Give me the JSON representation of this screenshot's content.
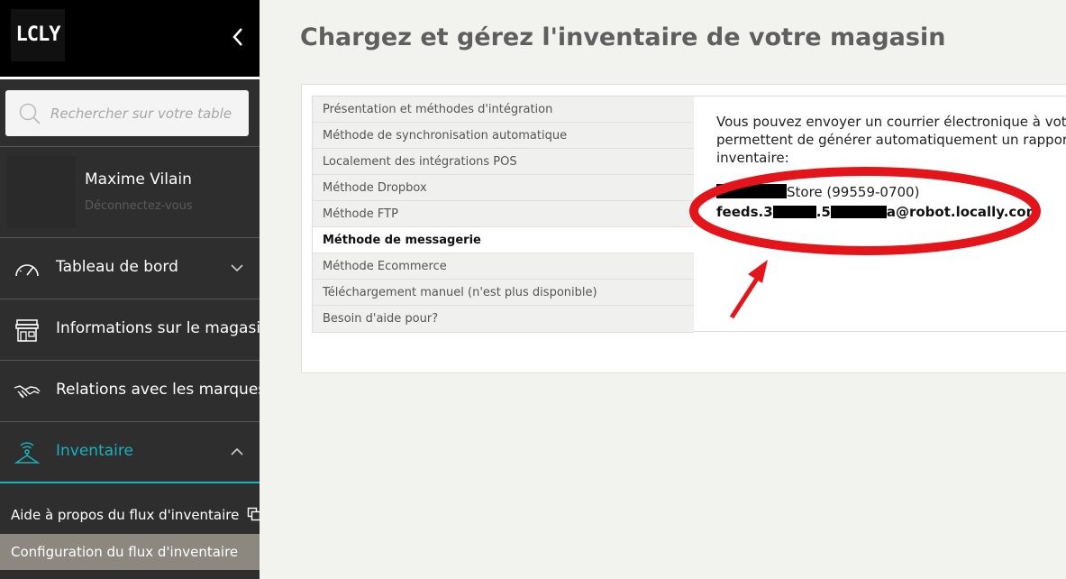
{
  "sidebar": {
    "logo": "LCLY",
    "search_placeholder": "Rechercher sur votre table",
    "user": {
      "name": "Maxime Vilain",
      "logout": "Déconnectez-vous"
    },
    "nav": [
      {
        "label": "Tableau de bord",
        "icon": "gauge-icon"
      },
      {
        "label": "Informations sur le magasin",
        "icon": "store-icon"
      },
      {
        "label": "Relations avec les marques",
        "icon": "handshake-icon"
      },
      {
        "label": "Inventaire",
        "icon": "hanger-signal-icon",
        "active": true
      }
    ],
    "sub_items": [
      {
        "label": "Aide à propos du flux d'inventaire"
      },
      {
        "label": "Configuration du flux d'inventaire",
        "selected": true
      }
    ],
    "accent_color": "#19b1bc"
  },
  "main": {
    "title": "Chargez et gérez l'inventaire de votre magasin",
    "tabs": [
      "Présentation et méthodes d'intégration",
      "Méthode de synchronisation automatique",
      "Localement des intégrations POS",
      "Méthode Dropbox",
      "Méthode FTP",
      "Méthode de messagerie",
      "Méthode Ecommerce",
      "Téléchargement manuel (n'est plus disponible)",
      "Besoin d'aide pour?"
    ],
    "active_tab": "Méthode de messagerie",
    "panel": {
      "intro": "Vous pouvez envoyer un courrier électronique à votre permettent de générer automatiquement un rapport inventaire:",
      "store_suffix": "Store (99559-0700)",
      "feed_prefix": "feeds.3",
      "feed_mid": ".5",
      "feed_suffix": "a@robot.locally.com"
    }
  },
  "annotation": {
    "color": "#e3151a"
  }
}
